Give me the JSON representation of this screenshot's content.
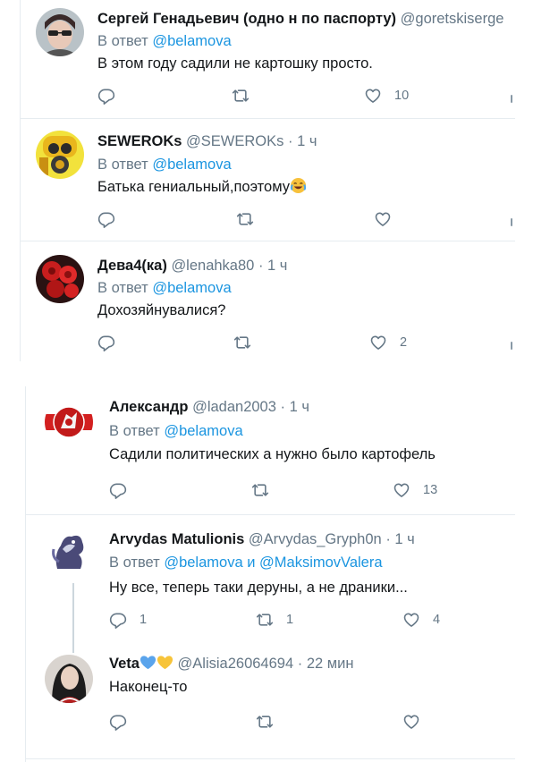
{
  "panel1": {
    "tweets": [
      {
        "name": "Сергей Генадьевич (одно н по паспорту)",
        "handle": "@goretskiserge",
        "reply_prefix": "В ответ",
        "mention1": "@belamova",
        "text": "В этом году садили не картошку просто.",
        "likes": "10",
        "avatar_icon": "person-glasses-avatar"
      },
      {
        "name": "SEWEROKs",
        "handle": "@SEWEROKs",
        "dot": "·",
        "time": "1 ч",
        "reply_prefix": "В ответ",
        "mention1": "@belamova",
        "text": "Батька гениальный,поэтому",
        "emoji": "tears-of-joy-emoji",
        "avatar_icon": "gas-mask-avatar"
      },
      {
        "name": "Дева4(ка)",
        "handle": "@lenahka80",
        "dot": "·",
        "time": "1 ч",
        "reply_prefix": "В ответ",
        "mention1": "@belamova",
        "text": "Дохозяйнувалися?",
        "likes": "2",
        "avatar_icon": "red-roses-avatar"
      }
    ]
  },
  "panel2": {
    "tweets": [
      {
        "name": "Александр",
        "handle": "@ladan2003",
        "dot": "·",
        "time": "1 ч",
        "reply_prefix": "В ответ",
        "mention1": "@belamova",
        "text": "Садили политических а нужно было картофель",
        "likes": "13",
        "avatar_icon": "knight-emblem-avatar"
      },
      {
        "name": "Arvydas Matulionis",
        "handle": "@Arvydas_Gryph0n",
        "dot": "·",
        "time": "1 ч",
        "reply_prefix": "В ответ",
        "mention1": "@belamova",
        "conj": "и",
        "mention2": "@MaksimovValera",
        "text": "Ну все, теперь таки деруны, а не драники...",
        "replies": "1",
        "retweets": "1",
        "likes": "4",
        "avatar_icon": "griffin-avatar"
      },
      {
        "name": "Veta",
        "name_emoji": [
          "blue-heart-emoji",
          "yellow-heart-emoji"
        ],
        "handle": "@Alisia26064694",
        "dot": "·",
        "time": "22 мин",
        "text": "Наконец-то",
        "avatar_icon": "woman-portrait-avatar"
      }
    ]
  },
  "colors": {
    "text": "#14171a",
    "muted": "#657786",
    "link": "#1b95e0",
    "border": "#e6ecf0",
    "thread_line": "#ccd6dd"
  }
}
